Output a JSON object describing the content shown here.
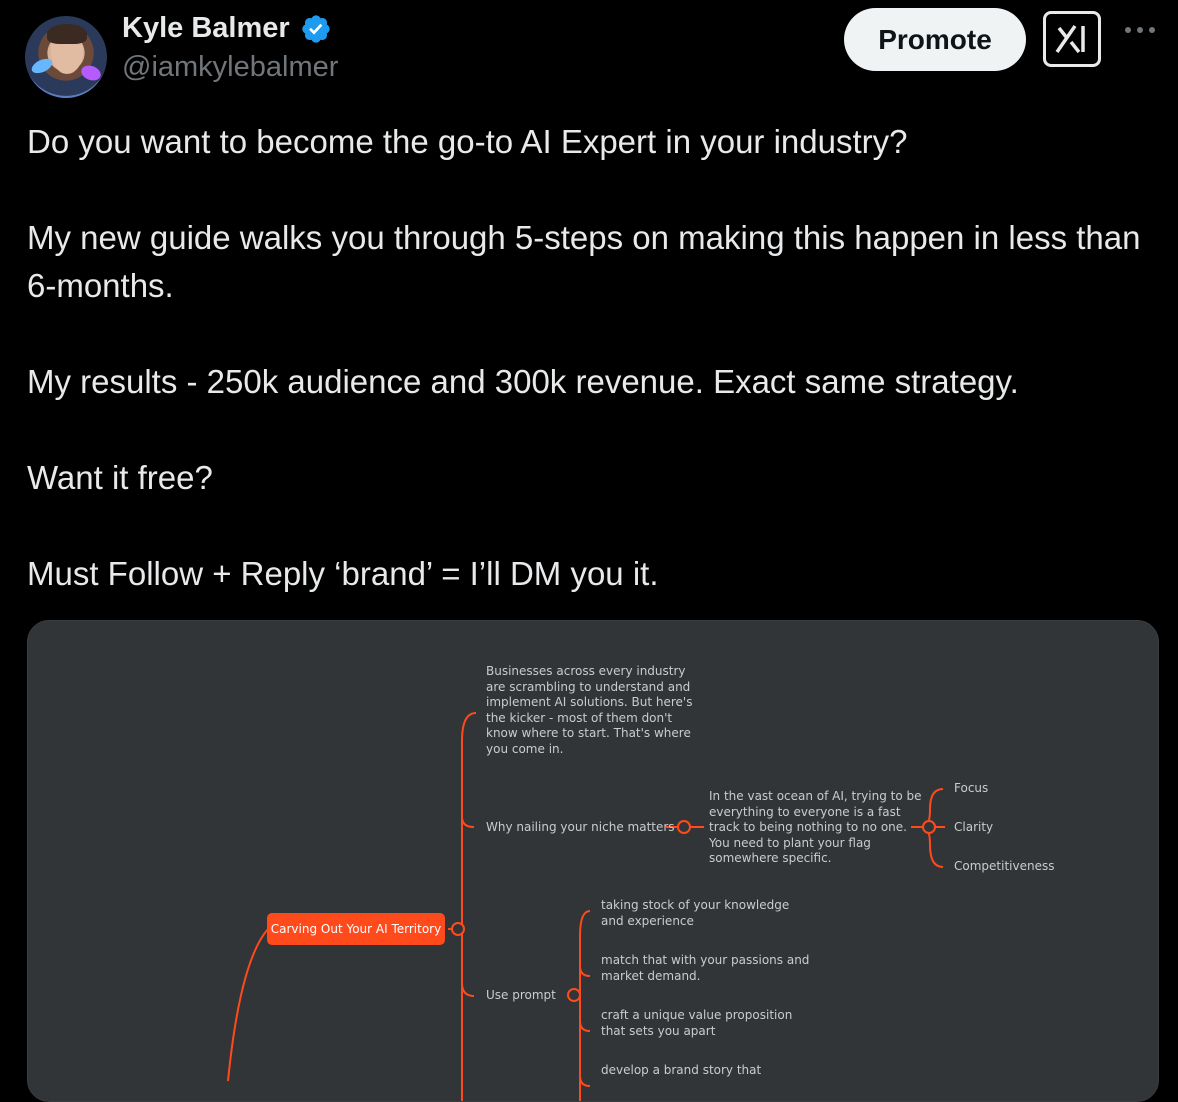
{
  "author": {
    "name": "Kyle Balmer",
    "handle": "@iamkylebalmer",
    "verified": true
  },
  "actions": {
    "promote_label": "Promote",
    "grok_icon": "grok-icon",
    "more_icon": "more-icon"
  },
  "post": {
    "lines": [
      "Do you want to become the go-to AI Expert in your industry?",
      "My new guide walks you through 5-steps on making this happen in less than 6-months.",
      "My results - 250k audience and 300k revenue. Exact same strategy.",
      "Want it free?",
      "Must Follow + Reply ‘brand’ = I’ll DM you it."
    ]
  },
  "mindmap": {
    "root": "Carving Out Your AI Territory",
    "intro": [
      "Businesses across every industry",
      "are scrambling to understand and",
      "implement AI solutions. But here's",
      "the kicker - most of them don't",
      "know where to start. That's where",
      "you come in."
    ],
    "niche": {
      "label": "Why nailing your niche matters",
      "detail": [
        "In the vast ocean of AI, trying to be",
        "everything to everyone is a fast",
        "track to being nothing to no one.",
        "You need to plant your flag",
        "somewhere specific."
      ],
      "items": [
        "Focus",
        "Clarity",
        "Competitiveness"
      ]
    },
    "prompt": {
      "label": "Use prompt",
      "items": [
        [
          "taking stock of your knowledge",
          "and experience"
        ],
        [
          "match that with your passions and",
          "market demand."
        ],
        [
          "craft a unique value proposition",
          "that sets you apart"
        ],
        [
          "develop a brand story that"
        ]
      ]
    }
  },
  "colors": {
    "accent": "#1d9bf0",
    "mindmap_line": "#ff4a1c",
    "mindmap_bg": "#323538"
  }
}
